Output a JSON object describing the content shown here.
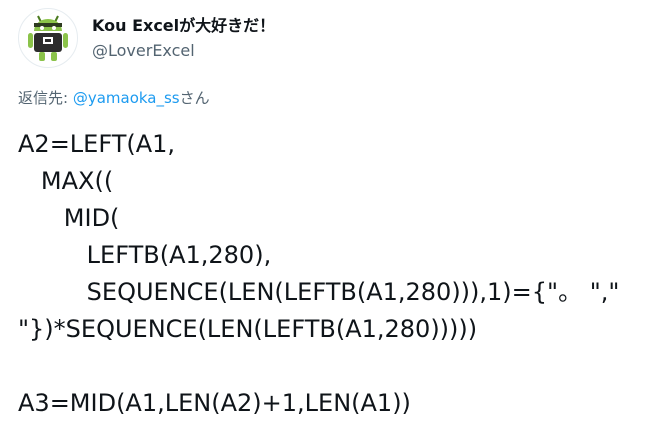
{
  "tweet": {
    "author": {
      "display_name": "Kou Excelが大好きだ！",
      "handle": "@LoverExcel",
      "avatar_icon": "android-robot-avatar-icon"
    },
    "reply_to": {
      "prefix": "返信先: ",
      "mention": "@yamaoka_ss",
      "suffix": "さん"
    },
    "body_lines": [
      "A2=LEFT(A1,",
      "   MAX((",
      "      MID(",
      "         LEFTB(A1,280),",
      "         SEQUENCE(LEN(LEFTB(A1,280))),1)={\"。 \",\"",
      "\"})*SEQUENCE(LEN(LEFTB(A1,280)))))",
      "",
      "A3=MID(A1,LEN(A2)+1,LEN(A1))"
    ]
  },
  "colors": {
    "text_primary": "#0f1419",
    "text_secondary": "#536471",
    "link": "#1d9bf0",
    "avatar_robot": "#8bc34a"
  }
}
